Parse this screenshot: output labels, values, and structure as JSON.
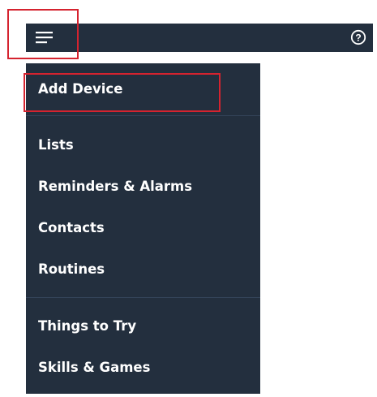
{
  "header": {
    "menu_icon": "hamburger-menu-icon",
    "help_icon": "help-circle-icon",
    "help_glyph": "?"
  },
  "drawer": {
    "sections": [
      {
        "items": [
          {
            "label": "Add Device",
            "highlighted": true
          }
        ]
      },
      {
        "items": [
          {
            "label": "Lists"
          },
          {
            "label": "Reminders & Alarms"
          },
          {
            "label": "Contacts"
          },
          {
            "label": "Routines"
          }
        ]
      },
      {
        "items": [
          {
            "label": "Things to Try"
          },
          {
            "label": "Skills & Games"
          }
        ]
      }
    ]
  },
  "colors": {
    "bar_background": "#232f3e",
    "text": "#ffffff",
    "highlight_box": "#d5232f",
    "divider": "#34445a"
  }
}
